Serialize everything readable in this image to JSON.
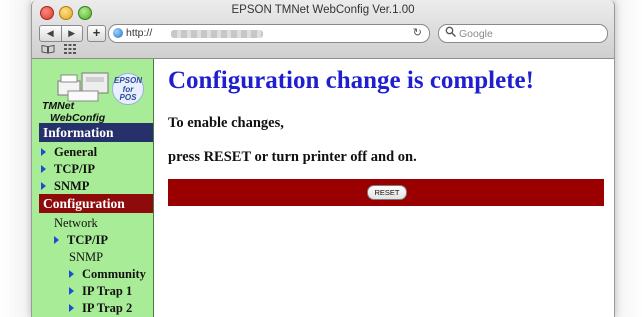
{
  "window": {
    "title": "EPSON TMNet WebConfig Ver.1.00"
  },
  "toolbar": {
    "back_glyph": "◀",
    "forward_glyph": "▶",
    "add_glyph": "+",
    "url": "http://",
    "reload_glyph": "↻",
    "search_placeholder": "Google"
  },
  "logo": {
    "line1": "TMNet",
    "line2": "WebConfig",
    "badge": "EPSON\nfor\nPOS"
  },
  "sidebar": {
    "information_header": "Information",
    "information_items": [
      "General",
      "TCP/IP",
      "SNMP"
    ],
    "configuration_header": "Configuration",
    "network_label": "Network",
    "network_tcpip": "TCP/IP",
    "snmp_label": "SNMP",
    "snmp_items": [
      "Community",
      "IP Trap 1",
      "IP Trap 2"
    ]
  },
  "main": {
    "headline": "Configuration change is complete!",
    "message_line1": "To enable changes,",
    "message_line2": "press RESET or turn printer off and on.",
    "reset_label": "RESET"
  },
  "colors": {
    "sidebar_bg": "#a8ec98",
    "info_header_bg": "#26306a",
    "config_header_bg": "#8f0b0b",
    "headline": "#1f1fd0",
    "reset_bar": "#9a0000"
  }
}
